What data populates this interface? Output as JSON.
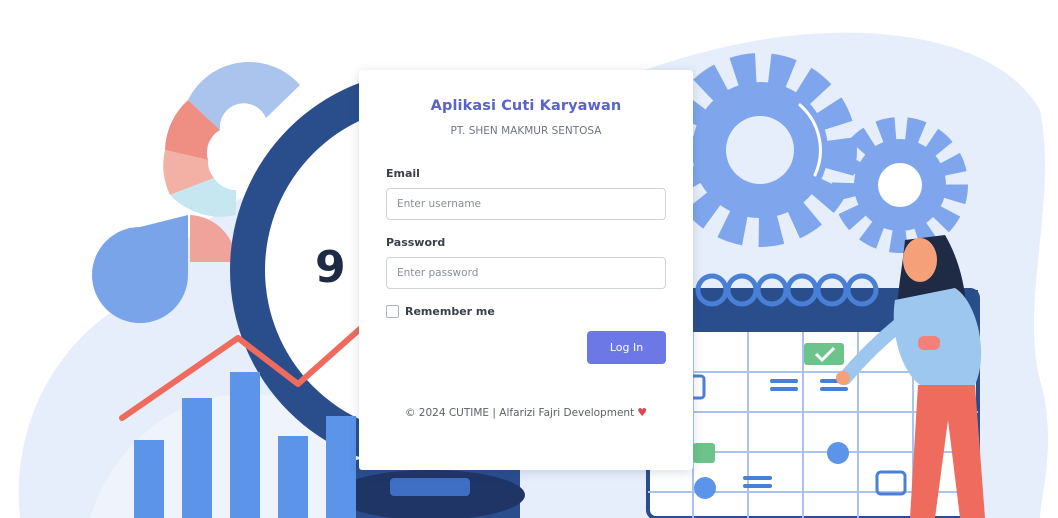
{
  "app": {
    "title": "Aplikasi Cuti Karyawan",
    "company": "PT. SHEN MAKMUR SENTOSA"
  },
  "form": {
    "email_label": "Email",
    "email_placeholder": "Enter username",
    "email_value": "",
    "password_label": "Password",
    "password_placeholder": "Enter password",
    "password_value": "",
    "remember_label": "Remember me",
    "remember_checked": false,
    "login_label": "Log In"
  },
  "footer": {
    "text": "© 2024 CUTIME | Alfarizi Fajri Development",
    "heart_icon": "heart-icon"
  },
  "illustration": {
    "clock_digit": "9"
  },
  "colors": {
    "accent": "#5a64c8",
    "button": "#6b78e5",
    "heart": "#e0454e",
    "background_shape": "#e6eefb"
  }
}
